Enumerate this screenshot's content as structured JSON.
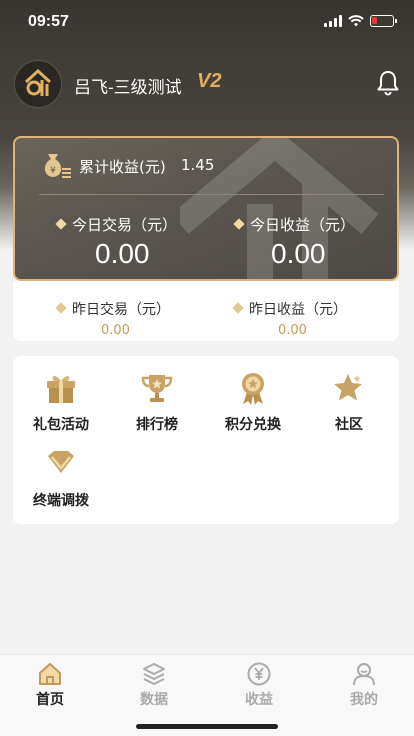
{
  "status_bar": {
    "time": "09:57"
  },
  "header": {
    "user_name": "吕飞-三级测试",
    "level": "V2"
  },
  "earnings": {
    "total_label": "累计收益(元)",
    "total_value": "1.45",
    "today_trade_label": "今日交易（元）",
    "today_trade_value": "0.00",
    "today_income_label": "今日收益（元）",
    "today_income_value": "0.00",
    "yesterday_trade_label": "昨日交易（元）",
    "yesterday_trade_value": "0.00",
    "yesterday_income_label": "昨日收益（元）",
    "yesterday_income_value": "0.00"
  },
  "menu": {
    "items": [
      {
        "label": "礼包活动",
        "icon": "gift-box-icon"
      },
      {
        "label": "排行榜",
        "icon": "trophy-icon"
      },
      {
        "label": "积分兑换",
        "icon": "medal-icon"
      },
      {
        "label": "社区",
        "icon": "star-icon"
      },
      {
        "label": "终端调拨",
        "icon": "diamond-icon"
      }
    ]
  },
  "tabbar": {
    "tabs": [
      {
        "label": "首页",
        "icon": "home-icon",
        "active": true
      },
      {
        "label": "数据",
        "icon": "layers-icon",
        "active": false
      },
      {
        "label": "收益",
        "icon": "yen-coin-icon",
        "active": false
      },
      {
        "label": "我的",
        "icon": "user-icon",
        "active": false
      }
    ]
  },
  "colors": {
    "accent_gold": "#dcb47a",
    "header_dark": "#38342f",
    "battery_low": "#e53935"
  }
}
